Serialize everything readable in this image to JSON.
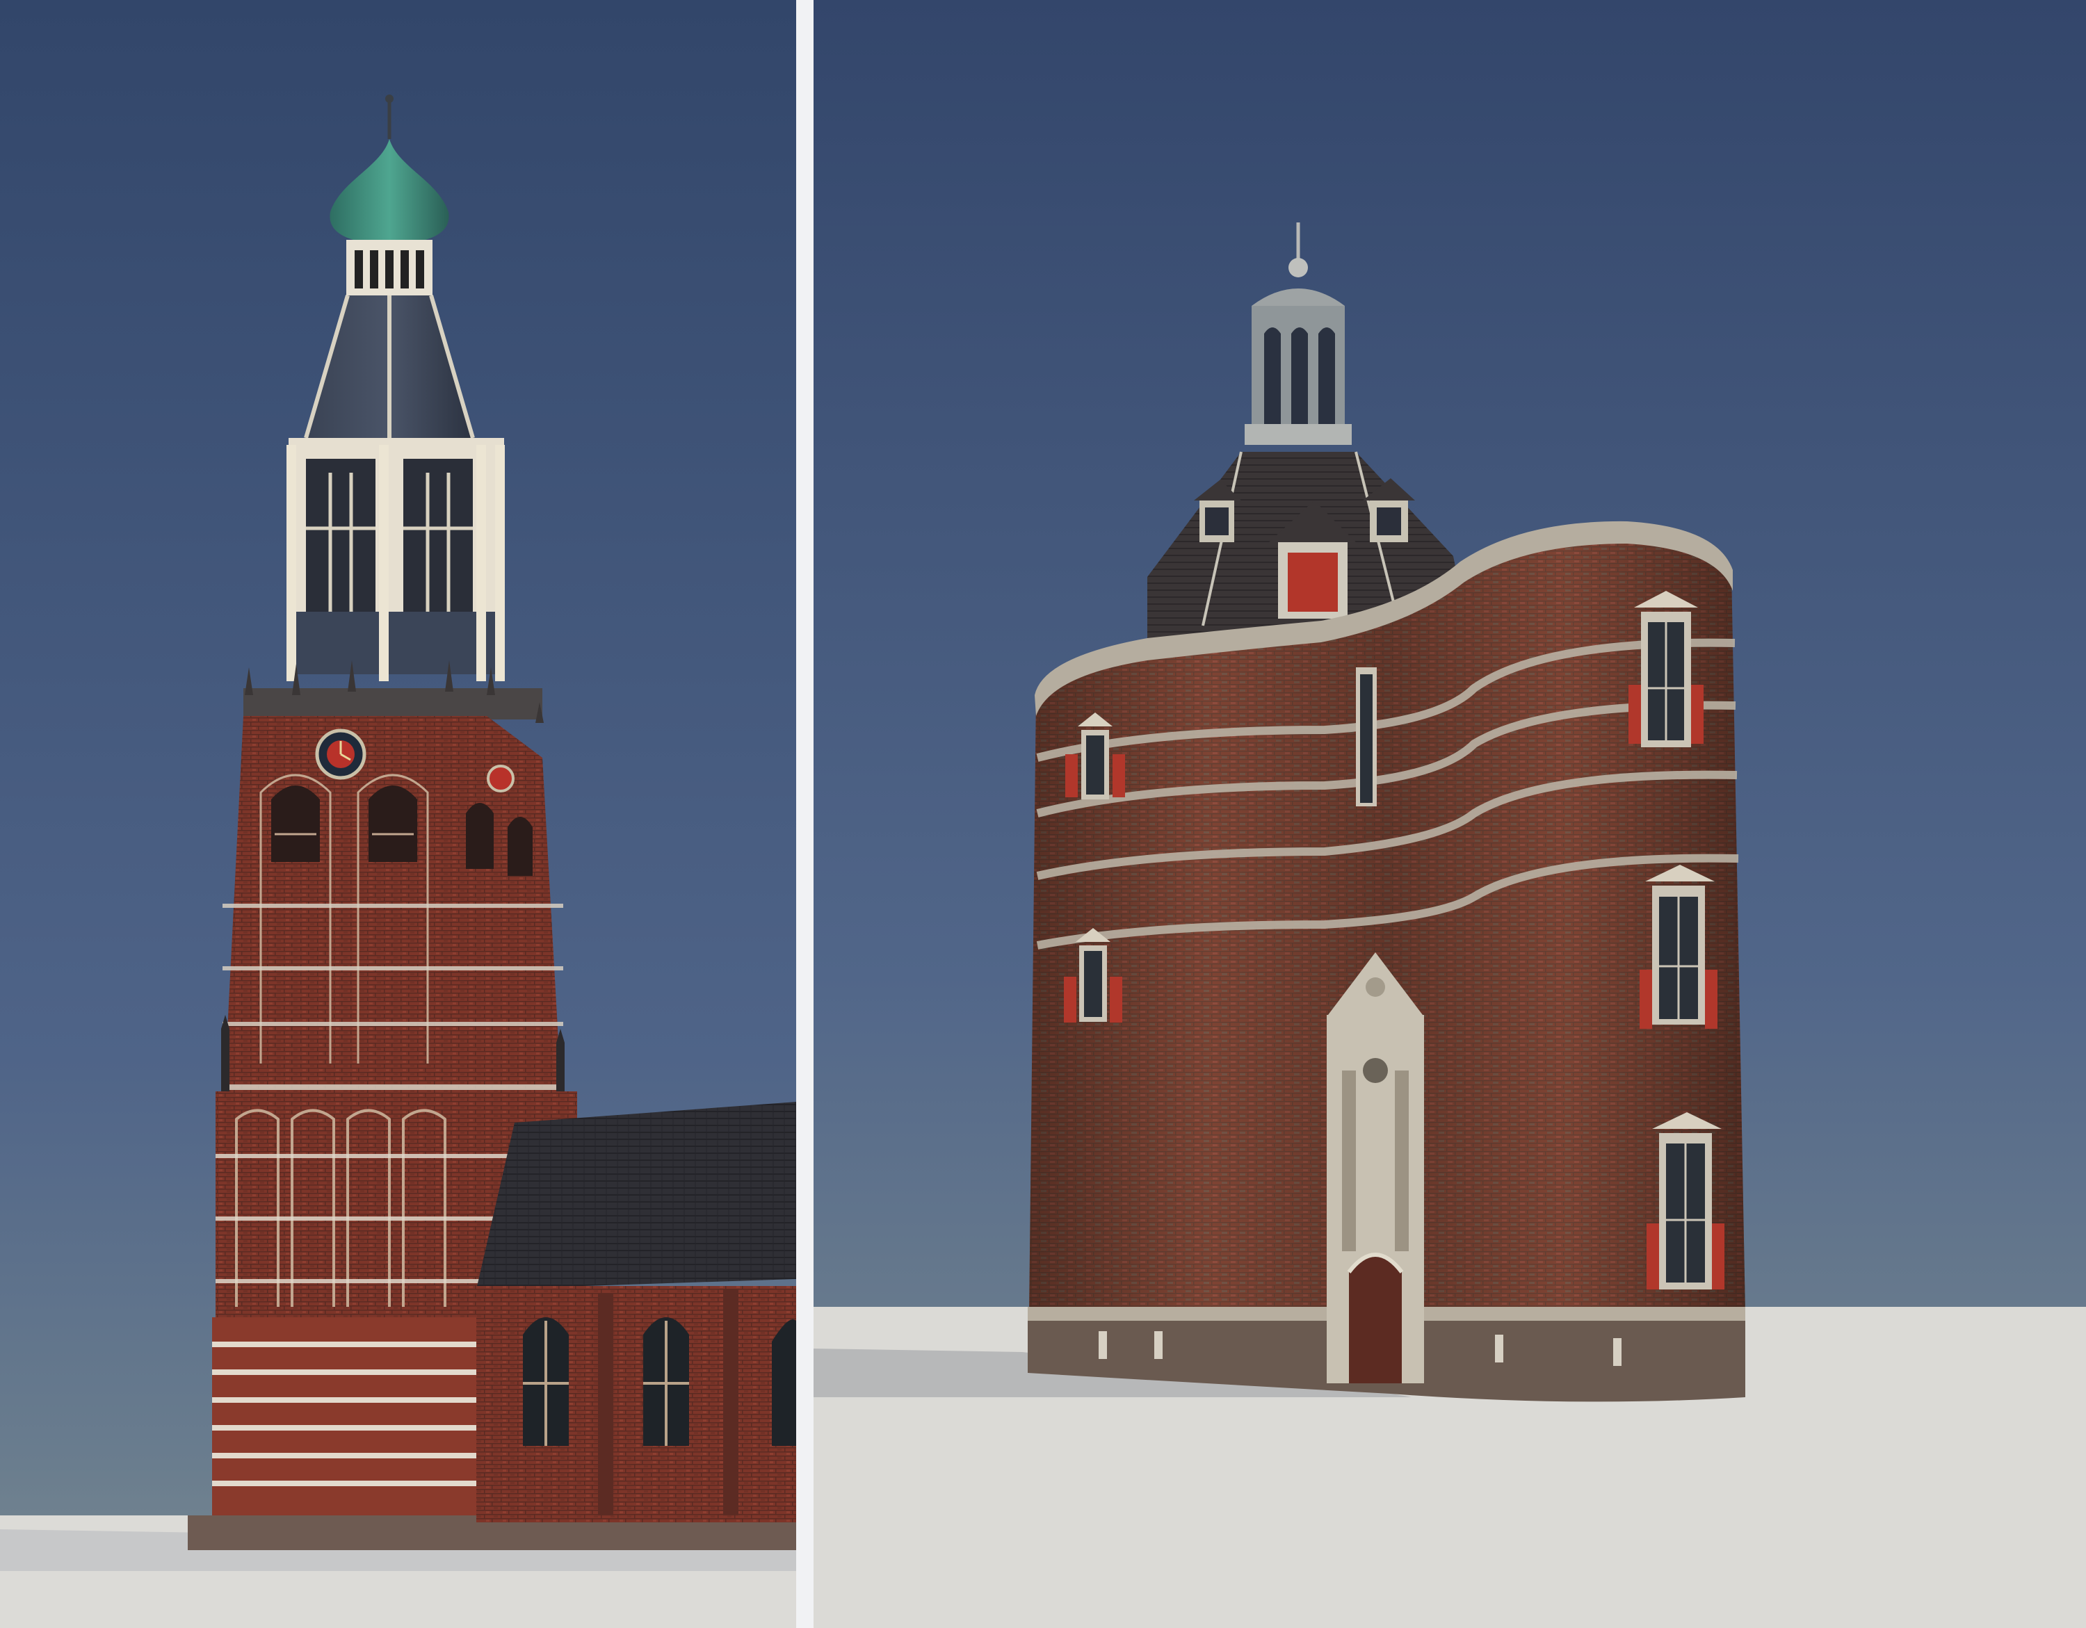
{
  "image": {
    "kind": "photoreal 3D renders",
    "panels": [
      "church-tower",
      "city-gate-tower"
    ]
  },
  "colors": {
    "sky_top": "#32466a",
    "sky_mid": "#4e6387",
    "sky_horizon": "#6f8090",
    "ground": "#d9d8d4",
    "brick": "#8a3a2c",
    "brick_dark": "#5a2a22",
    "stone_band": "#b7aea0",
    "slate": "#3e4450",
    "copper": "#3f8e7c",
    "shutter_red": "#b1372b",
    "panel_divider": "#f1f2f4"
  }
}
